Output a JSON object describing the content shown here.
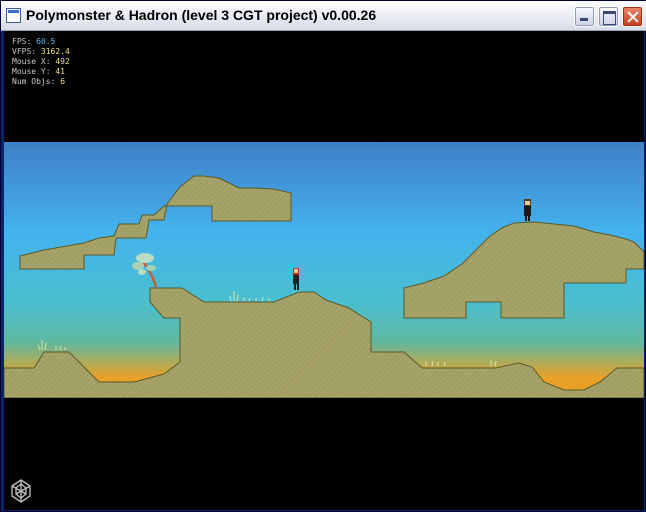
{
  "window": {
    "title": "Polymonster & Hadron (level 3 CGT project) v0.00.26"
  },
  "hud": {
    "fps_label": "FPS:",
    "fps_value": "60.5",
    "vfps_label": "VFPS:",
    "vfps_value": "3162.4",
    "mouse_x_label": "Mouse X:",
    "mouse_x_value": "492",
    "mouse_y_label": "Mouse Y:",
    "mouse_y_value": "41",
    "num_objs_label": "Num Objs:",
    "num_objs_value": "6"
  },
  "colors": {
    "sky_top": "#3f7fc6",
    "sky_mid": "#42aee8",
    "sky_low": "#49c0c4",
    "horizon": "#e8a228",
    "ground": "#a6a36a",
    "ground_outline": "#5a5a28",
    "hud_blue": "#52b9ff",
    "hud_yellow": "#f0e070"
  },
  "icons": {
    "app": "window-app-icon",
    "minimize": "minimize-icon",
    "maximize": "maximize-icon",
    "close": "close-icon",
    "logo": "polymonster-logo-icon"
  }
}
